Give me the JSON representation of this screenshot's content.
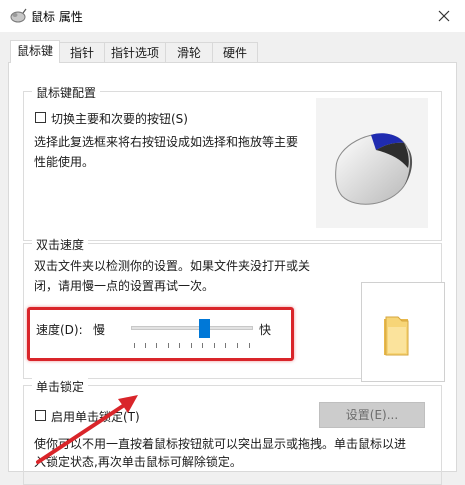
{
  "window": {
    "title": "鼠标 属性",
    "close_icon": "close-icon",
    "app_icon": "mouse-app-icon"
  },
  "tabs": [
    {
      "label": "鼠标键",
      "active": true
    },
    {
      "label": "指针",
      "active": false
    },
    {
      "label": "指针选项",
      "active": false
    },
    {
      "label": "滑轮",
      "active": false
    },
    {
      "label": "硬件",
      "active": false
    }
  ],
  "button_config": {
    "title": "鼠标键配置",
    "checkbox_label": "切换主要和次要的按钮(S)",
    "checked": false,
    "description_line1": "选择此复选框来将右按钮设成如选择和拖放等主要",
    "description_line2": "性能使用。"
  },
  "double_click": {
    "title": "双击速度",
    "description_line1": "双击文件夹以检测你的设置。如果文件夹没打开或关",
    "description_line2": "闭，请用慢一点的设置再试一次。",
    "speed_label": "速度(D):",
    "slow_label": "慢",
    "fast_label": "快",
    "speed_level": 0.6
  },
  "click_lock": {
    "title": "单击锁定",
    "checkbox_label": "启用单击锁定(T)",
    "checked": false,
    "settings_button": "设置(E)...",
    "description_line1": "使你可以不用一直按着鼠标按钮就可以突出显示或拖拽。单击鼠标以进",
    "description_line2": "入锁定状态,再次单击鼠标可解除锁定。"
  },
  "colors": {
    "accent": "#0078d7",
    "highlight": "#d9252a"
  }
}
